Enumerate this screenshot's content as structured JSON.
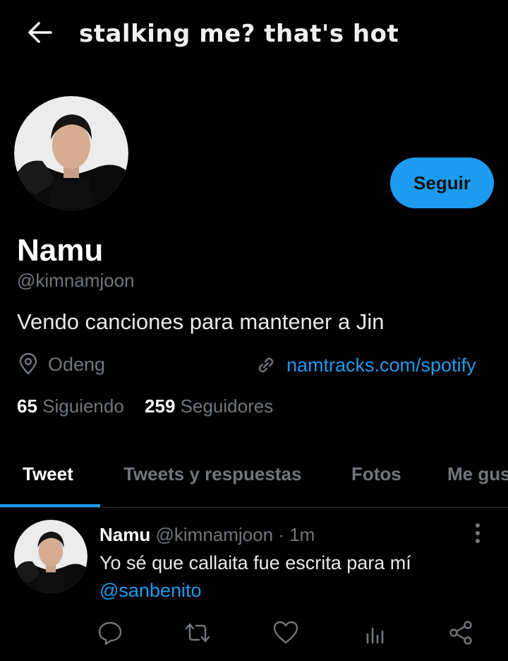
{
  "header": {
    "title": "stalking me? that's hot"
  },
  "profile": {
    "display_name": "Namu",
    "handle": "@kimnamjoon",
    "bio": "Vendo canciones para mantener a Jin",
    "location": "Odeng",
    "link": "namtracks.com/spotify",
    "following_count": "65",
    "following_label": "Siguiendo",
    "followers_count": "259",
    "followers_label": "Seguidores",
    "follow_button": "Seguir"
  },
  "tabs": [
    {
      "label": "Tweet",
      "active": true
    },
    {
      "label": "Tweets y respuestas",
      "active": false
    },
    {
      "label": "Fotos",
      "active": false
    },
    {
      "label": "Me gusta",
      "active": false
    }
  ],
  "tweet": {
    "name": "Namu",
    "handle": "@kimnamjoon",
    "separator": "·",
    "time": "1m",
    "text": "Yo sé que callaita fue escrita para mí",
    "mention": "@sanbenito",
    "actions": [
      "reply-icon",
      "retweet-icon",
      "like-icon",
      "analytics-icon",
      "share-icon"
    ]
  },
  "colors": {
    "background": "#000000",
    "accent": "#1d9bf0",
    "muted": "#71767b",
    "text": "#e7e9ea"
  }
}
